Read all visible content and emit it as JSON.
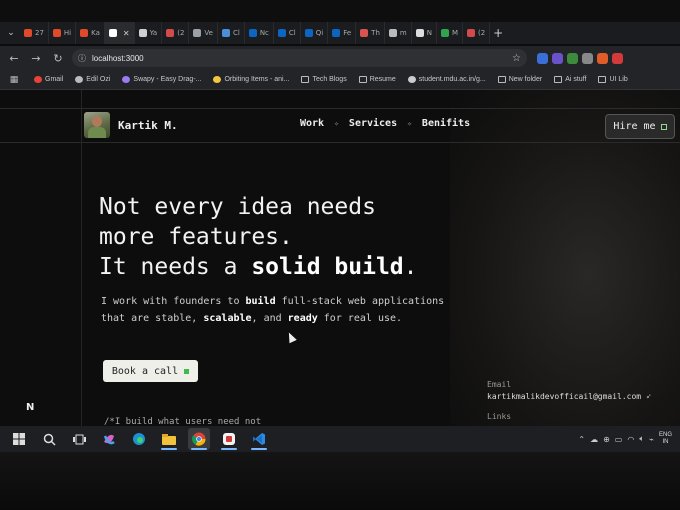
{
  "browser": {
    "tabs": [
      {
        "label": "27",
        "color": "#e0492a"
      },
      {
        "label": "Hi",
        "color": "#e0492a"
      },
      {
        "label": "Ka",
        "color": "#e0492a"
      },
      {
        "label": "",
        "color": "#ffffff",
        "active": true
      },
      {
        "label": "Ya",
        "color": "#cfcfcf"
      },
      {
        "label": "(2",
        "color": "#d34a4a"
      },
      {
        "label": "Ve",
        "color": "#9aa0a6"
      },
      {
        "label": "Cl",
        "color": "#4a90d9"
      },
      {
        "label": "Nc",
        "color": "#0a66c2"
      },
      {
        "label": "Cl",
        "color": "#0a66c2"
      },
      {
        "label": "Qi",
        "color": "#0a66c2"
      },
      {
        "label": "Fe",
        "color": "#0a66c2"
      },
      {
        "label": "Th",
        "color": "#d9534f"
      },
      {
        "label": "m",
        "color": "#bbbbbb"
      },
      {
        "label": "N",
        "color": "#dddddd"
      },
      {
        "label": "M",
        "color": "#2ea44f"
      },
      {
        "label": "(2",
        "color": "#d34a4a"
      }
    ],
    "url": "localhost:3000",
    "bookmarks": [
      {
        "label": "Gmail",
        "color": "#ea4335"
      },
      {
        "label": "Edil Ozi",
        "color": "#bbbbbb"
      },
      {
        "label": "Swapy - Easy Drag-...",
        "color": "#9b7cf0"
      },
      {
        "label": "Orbiting Items - ani...",
        "color": "#f5c542"
      },
      {
        "label": "Tech Blogs",
        "folder": true
      },
      {
        "label": "Resume",
        "folder": true
      },
      {
        "label": "student.mdu.ac.in/g...",
        "color": "#cccccc"
      },
      {
        "label": "New folder",
        "folder": true
      },
      {
        "label": "Ai stuff",
        "folder": true
      },
      {
        "label": "UI Lib",
        "folder": true
      }
    ],
    "extension_colors": [
      "#3b6fd8",
      "#6a52c9",
      "#3d8c3d",
      "#888888",
      "#e05d2a",
      "#d33a3a"
    ]
  },
  "site": {
    "brand": "Kartik M.",
    "nav": {
      "work": "Work",
      "services": "Services",
      "benefits": "Benifits",
      "separator": "✧"
    },
    "hire_label": "Hire me",
    "hero": {
      "line1": "Not every idea needs",
      "line2": "more features.",
      "line3_prefix": "It needs a ",
      "line3_bold": "solid build",
      "line3_suffix": "."
    },
    "sub": {
      "p1": "I work with founders to ",
      "b1": "build",
      "p2": " full-stack web applications that are stable, ",
      "b2": "scalable",
      "p3": ", and ",
      "b3": "ready",
      "p4": " for real use."
    },
    "cta_label": "Book a call",
    "comment": "/*I build what users need not",
    "logo_mark": "N",
    "email_label": "Email",
    "email_value": "kartikmalikdevofficail@gmail.com",
    "links_label": "Links"
  },
  "taskbar": {
    "lang_line1": "ENG",
    "lang_line2": "IN"
  }
}
